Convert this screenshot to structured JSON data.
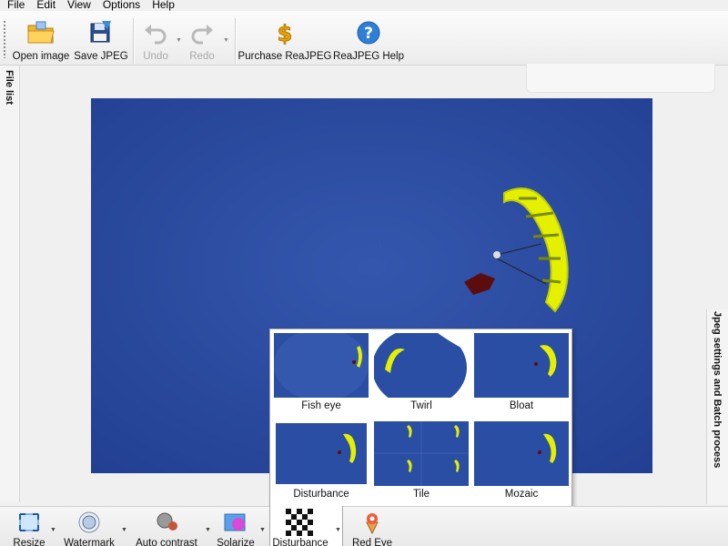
{
  "menu": [
    "File",
    "Edit",
    "View",
    "Options",
    "Help"
  ],
  "toolbar": {
    "open": "Open image",
    "save": "Save JPEG",
    "undo": "Undo",
    "redo": "Redo",
    "purchase": "Purchase ReaJPEG",
    "help": "ReaJPEG Help"
  },
  "side_tabs": {
    "left": "File list",
    "right": "Jpeg settings and Batch process"
  },
  "effects": [
    "Fish eye",
    "Twirl",
    "Bloat",
    "Disturbance",
    "Tile",
    "Mozaic"
  ],
  "bottom_toolbar": [
    "Resize",
    "Watermark",
    "Auto contrast",
    "Solarize",
    "Disturbance",
    "Red Eye"
  ],
  "colors": {
    "sky": "#2a4fa8",
    "parachute": "#e4f000",
    "help_icon": "#2f7fd8"
  }
}
